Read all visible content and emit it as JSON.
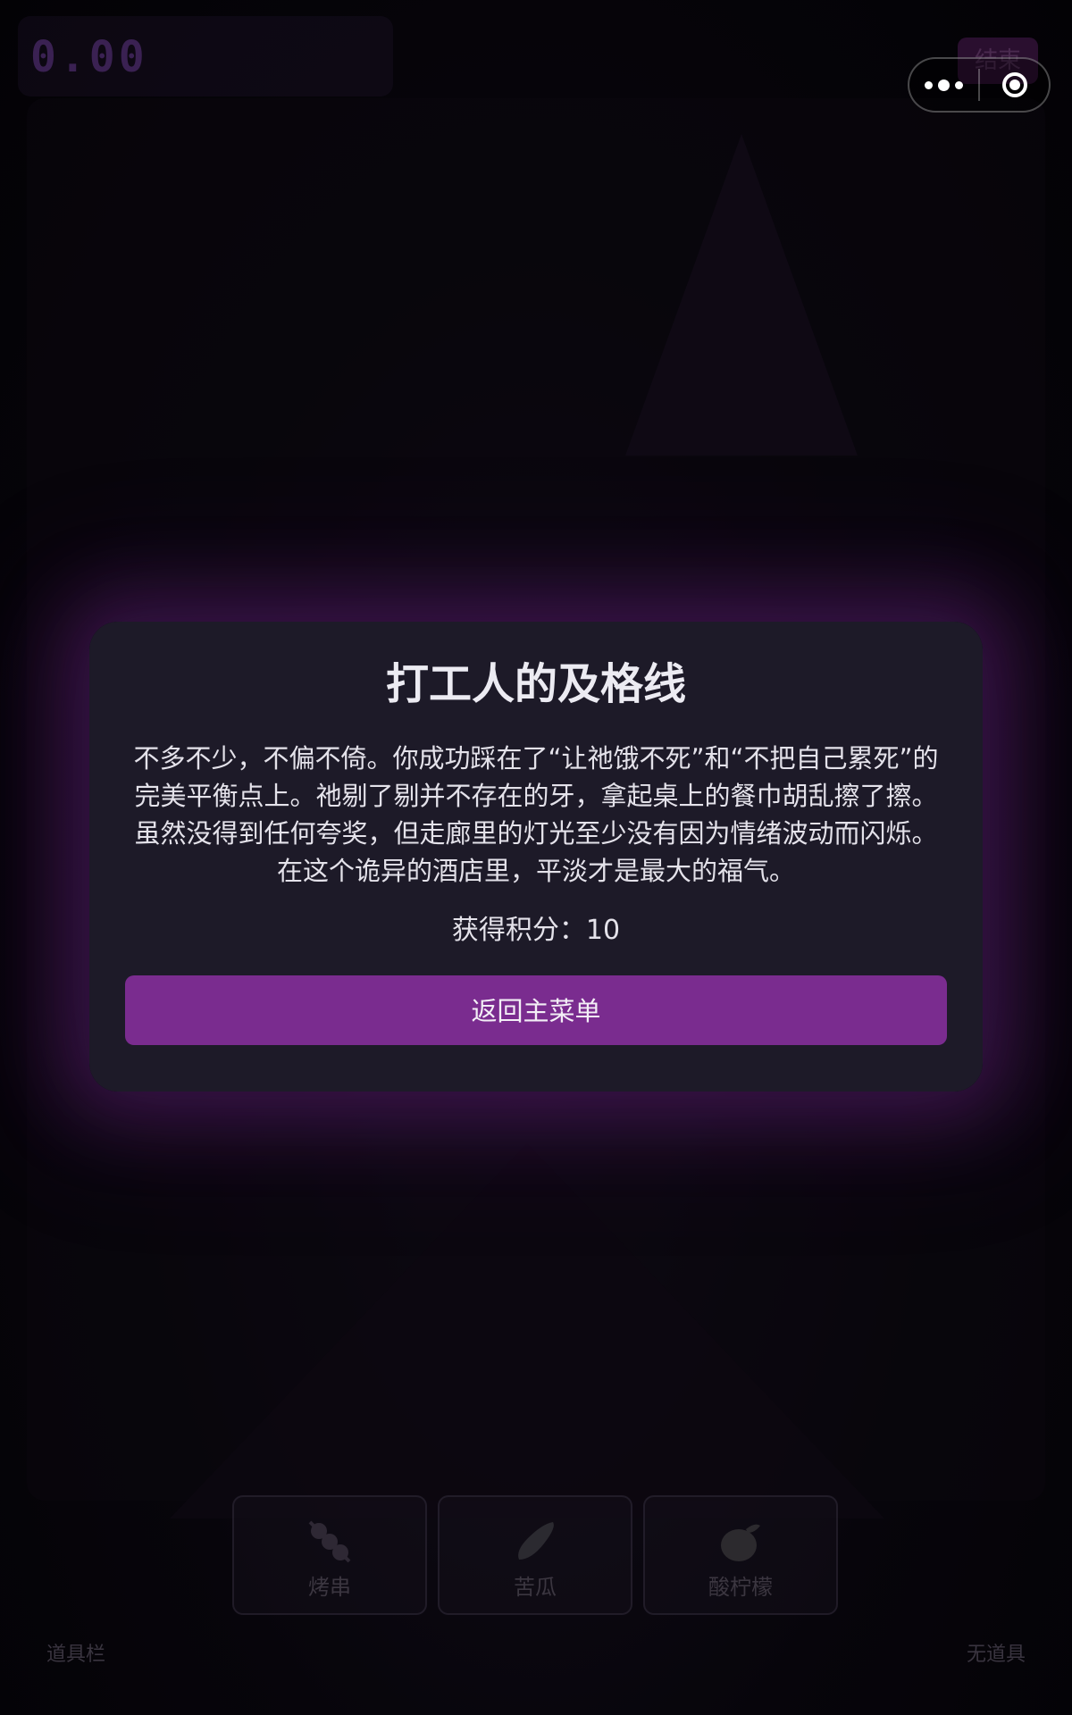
{
  "status": {
    "timer": "0.00",
    "end_button_label": "结束"
  },
  "capsule": {
    "more_icon": "more-dots-icon",
    "close_icon": "close-circle-icon"
  },
  "items": [
    {
      "name": "烤串",
      "icon": "skewer-icon"
    },
    {
      "name": "苦瓜",
      "icon": "bitter-melon-icon"
    },
    {
      "name": "酸柠檬",
      "icon": "lemon-icon"
    }
  ],
  "footer": {
    "item_bar_label": "道具栏",
    "no_items_label": "无道具"
  },
  "modal": {
    "title": "打工人的及格线",
    "body": "不多不少，不偏不倚。你成功踩在了“让祂饿不死”和“不把自己累死”的完美平衡点上。祂剔了剔并不存在的牙，拿起桌上的餐巾胡乱擦了擦。虽然没得到任何夸奖，但走廊里的灯光至少没有因为情绪波动而闪烁。在这个诡异的酒店里，平淡才是最大的福气。",
    "score_text": "获得积分：10",
    "button_label": "返回主菜单"
  },
  "colors": {
    "accent": "#7a2c8f",
    "modal_bg": "#1d1a28",
    "glow": "#782896"
  }
}
